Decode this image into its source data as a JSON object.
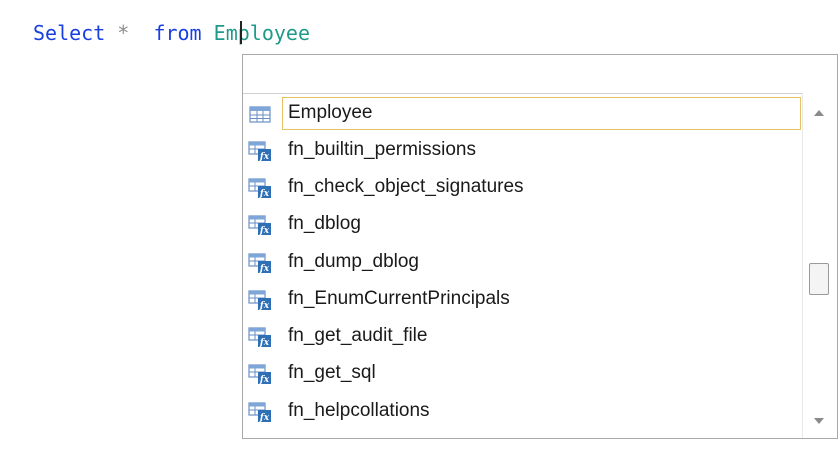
{
  "editor": {
    "keyword_select": "Select",
    "operator_star": "*",
    "keyword_from": "from",
    "identifier": "Employee"
  },
  "autocomplete": {
    "filter_value": "",
    "items": [
      {
        "label": "Employee",
        "icon": "table-icon",
        "selected": true
      },
      {
        "label": "fn_builtin_permissions",
        "icon": "table-valued-function-icon",
        "selected": false
      },
      {
        "label": "fn_check_object_signatures",
        "icon": "table-valued-function-icon",
        "selected": false
      },
      {
        "label": "fn_dblog",
        "icon": "table-valued-function-icon",
        "selected": false
      },
      {
        "label": "fn_dump_dblog",
        "icon": "table-valued-function-icon",
        "selected": false
      },
      {
        "label": "fn_EnumCurrentPrincipals",
        "icon": "table-valued-function-icon",
        "selected": false
      },
      {
        "label": "fn_get_audit_file",
        "icon": "table-valued-function-icon",
        "selected": false
      },
      {
        "label": "fn_get_sql",
        "icon": "table-valued-function-icon",
        "selected": false
      },
      {
        "label": "fn_helpcollations",
        "icon": "table-valued-function-icon",
        "selected": false
      }
    ]
  },
  "colors": {
    "keyword": "#1a3fe0",
    "operator": "#8c8c8c",
    "identifier": "#1f9a8a",
    "selection_border": "#e5c365"
  }
}
